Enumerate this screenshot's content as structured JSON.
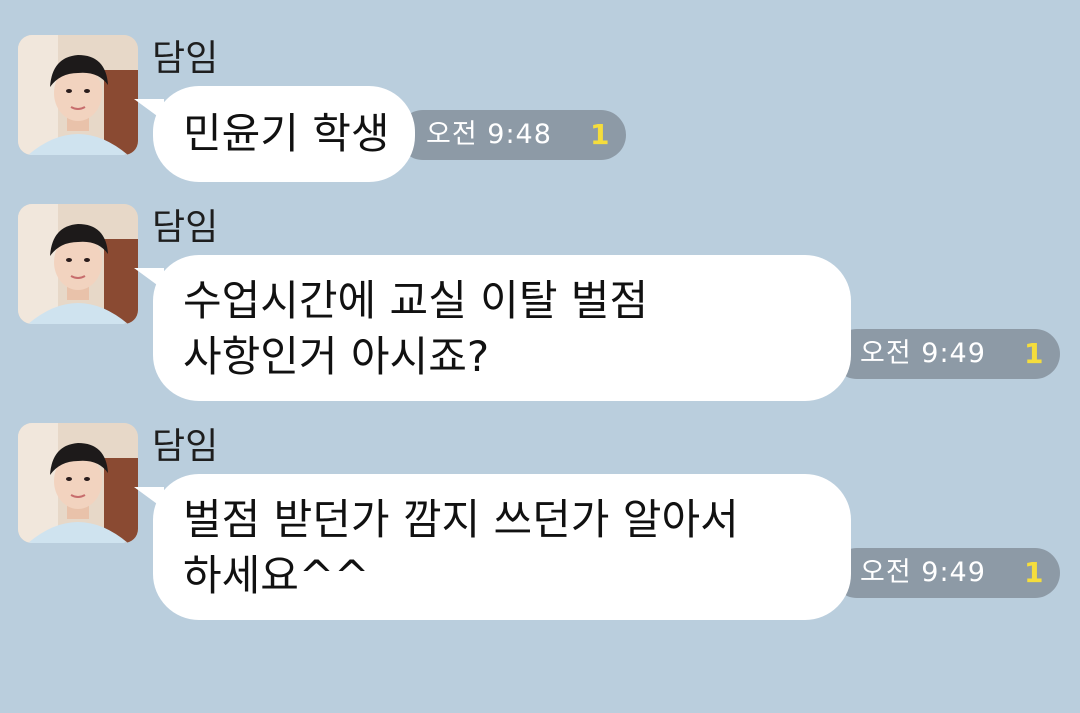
{
  "colors": {
    "background": "#bacedd",
    "bubble": "#ffffff",
    "status_pill": "#8d9aa6",
    "time_text": "#ffffff",
    "unread_text": "#f5dd3c"
  },
  "messages": [
    {
      "sender": "담임",
      "avatar": "teacher-avatar",
      "text": "민윤기 학생",
      "time": "오전 9:48",
      "unread": "1"
    },
    {
      "sender": "담임",
      "avatar": "teacher-avatar",
      "text": "수업시간에 교실 이탈 벌점\n사항인거 아시죠?",
      "time": "오전 9:49",
      "unread": "1"
    },
    {
      "sender": "담임",
      "avatar": "teacher-avatar",
      "text": "벌점 받던가 깜지 쓰던가 알아서\n하세요^^",
      "time": "오전 9:49",
      "unread": "1"
    }
  ]
}
